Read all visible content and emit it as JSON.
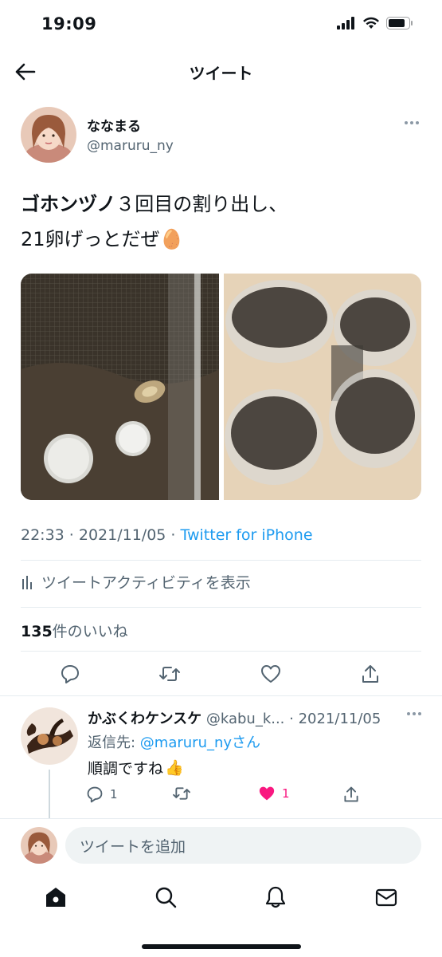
{
  "status_bar": {
    "time": "19:09"
  },
  "header": {
    "title": "ツイート"
  },
  "author": {
    "name": "ななまる",
    "handle": "@maruru_ny"
  },
  "tweet": {
    "text_bold": "ゴホンヅノ",
    "text_line1": "３回目の割り出し、",
    "text_line2": "21卵げっとだぜ",
    "emoji": "🥚",
    "timestamp": "22:33 · 2021/11/05 · ",
    "source": "Twitter for iPhone",
    "activity_label": "ツイートアクティビティを表示",
    "likes_count": "135",
    "likes_label": "件のいいね"
  },
  "reply": {
    "name": "かぶくわケンスケ",
    "handle": "@kabu_k...",
    "date": " · 2021/11/05",
    "reply_to_prefix": "返信先: ",
    "reply_to_mention": "@maruru_ny",
    "reply_to_suffix": "さん",
    "body": "順調ですね",
    "emoji": "👍",
    "reply_count": "1",
    "like_count": "1"
  },
  "compose": {
    "placeholder": "ツイートを追加"
  },
  "colors": {
    "accent": "#1d9bf0",
    "like": "#f91880",
    "muted": "#536471"
  },
  "icons": [
    "back-arrow-icon",
    "more-icon",
    "reply-icon",
    "retweet-icon",
    "like-icon",
    "share-icon",
    "analytics-icon",
    "home-icon",
    "search-icon",
    "notifications-icon",
    "messages-icon"
  ]
}
